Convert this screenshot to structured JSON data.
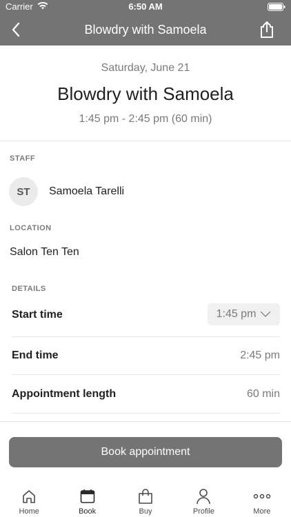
{
  "status_bar": {
    "carrier": "Carrier",
    "time": "6:50 AM"
  },
  "nav": {
    "title": "Blowdry with Samoela"
  },
  "header": {
    "date": "Saturday, June 21",
    "title": "Blowdry with Samoela",
    "time_range": "1:45 pm - 2:45 pm (60 min)"
  },
  "staff": {
    "section_label": "STAFF",
    "initials": "ST",
    "name": "Samoela Tarelli"
  },
  "location": {
    "section_label": "LOCATION",
    "name": "Salon Ten Ten"
  },
  "details": {
    "section_label": "DETAILS",
    "start_time": {
      "label": "Start time",
      "value": "1:45 pm"
    },
    "end_time": {
      "label": "End time",
      "value": "2:45 pm"
    },
    "length": {
      "label": "Appointment length",
      "value": "60 min"
    }
  },
  "book_button": {
    "label": "Book appointment"
  },
  "tabs": [
    {
      "label": "Home",
      "icon": "home-icon"
    },
    {
      "label": "Book",
      "icon": "calendar-icon",
      "active": true
    },
    {
      "label": "Buy",
      "icon": "shopping-bag-icon"
    },
    {
      "label": "Profile",
      "icon": "person-icon"
    },
    {
      "label": "More",
      "icon": "more-dots-icon"
    }
  ],
  "colors": {
    "bar": "#747474",
    "muted_text": "#7a7a7a",
    "divider": "#e6e6e6"
  }
}
